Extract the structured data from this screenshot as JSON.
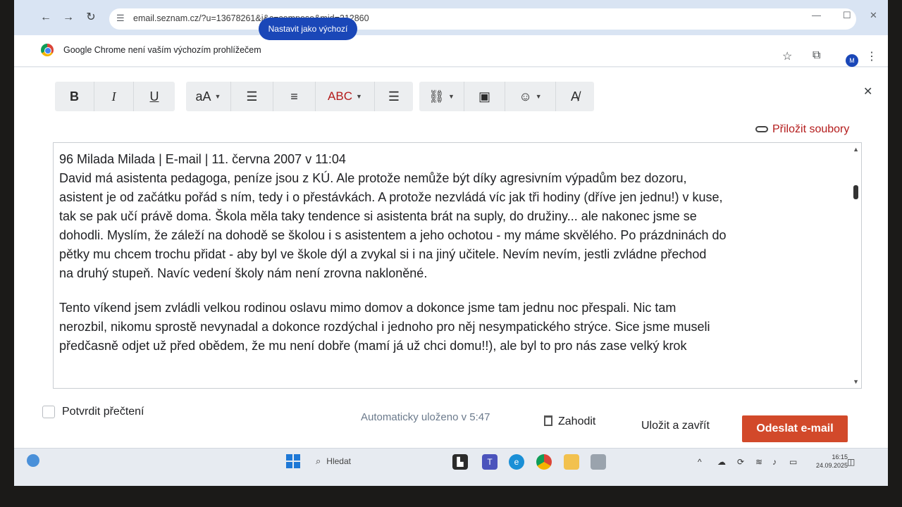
{
  "browser": {
    "url": "email.seznam.cz/?u=13678261&i&c=compose&mid=212860",
    "infobar_text": "Google Chrome není vaším výchozím prohlížečem",
    "set_default_label": "Nastavit jako výchozí",
    "avatar_initial": "M"
  },
  "toolbar": {
    "bold": "B",
    "italic": "I",
    "underline": "U",
    "font_size": "aA",
    "spellcheck": "ABC"
  },
  "attach_label": "Přiložit soubory",
  "editor": {
    "lines_p1": [
      "96 Milada Milada | E-mail | 11. června 2007 v 11:04",
      "David má asistenta pedagoga, peníze jsou z KÚ. Ale protože nemůže být díky agresivním výpadům bez dozoru,",
      "asistent je od začátku pořád s ním, tedy i o přestávkách. A protože nezvládá víc jak tři hodiny (dříve jen jednu!) v kuse,",
      "tak se pak učí právě doma. Škola měla taky tendence si asistenta brát na suply, do družiny... ale nakonec jsme se",
      "dohodli. Myslím, že záleží na dohodě se školou i s asistentem a jeho ochotou - my máme skvělého. Po prázdninách do",
      "pětky mu chcem trochu přidat - aby byl ve škole dýl a zvykal si i na jiný učitele. Nevím nevím, jestli zvládne přechod",
      "na druhý stupeň. Navíc vedení školy nám není zrovna nakloněné."
    ],
    "lines_p2": [
      "Tento víkend jsem zvládli velkou rodinou oslavu mimo domov a dokonce jsme tam jednu noc přespali. Nic tam",
      "nerozbil, nikomu sprostě nevynadal a dokonce rozdýchal i jednoho pro něj nesympatického strýce. Sice jsme museli",
      "předčasně odjet už před obědem, že mu  není dobře (mamí já už chci domu!!), ale byl to pro nás zase velký krok"
    ]
  },
  "footer": {
    "confirm_read": "Potvrdit přečtení",
    "autosave": "Automaticky uloženo v 5:47",
    "discard": "Zahodit",
    "save_close": "Uložit a zavřít",
    "send": "Odeslat e-mail"
  },
  "taskbar": {
    "search_label": "Hledat",
    "time": "16:15",
    "date": "24.09.2025"
  }
}
